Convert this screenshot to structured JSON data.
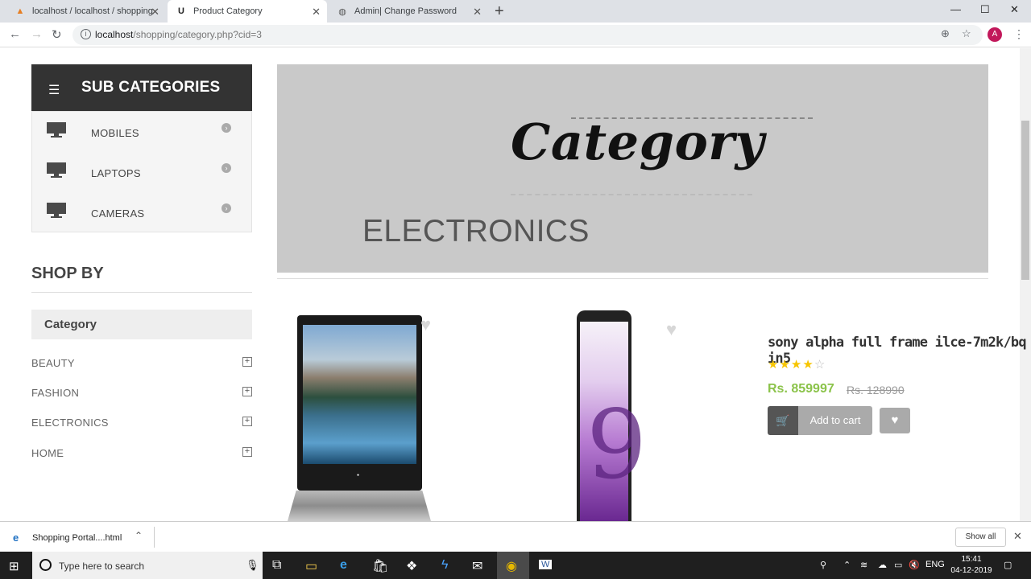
{
  "browser": {
    "tabs": [
      {
        "title": "localhost / localhost / shopping",
        "icon": "phpmyadmin-icon"
      },
      {
        "title": "Product Category",
        "icon": "page-u-icon"
      },
      {
        "title": "Admin| Change Password",
        "icon": "globe-icon"
      }
    ],
    "url_host": "localhost",
    "url_path": "/shopping/category.php?cid=3",
    "profile_initial": "A"
  },
  "sidebar": {
    "subcategories_title": "SUB CATEGORIES",
    "subcategories": [
      {
        "label": "MOBILES"
      },
      {
        "label": "LAPTOPS"
      },
      {
        "label": "CAMERAS"
      }
    ],
    "shop_by_title": "SHOP BY",
    "category_title": "Category",
    "categories": [
      {
        "label": "BEAUTY"
      },
      {
        "label": "FASHION"
      },
      {
        "label": "ELECTRONICS"
      },
      {
        "label": "HOME"
      }
    ]
  },
  "banner": {
    "script_text": "Category",
    "category_name": "ELECTRONICS"
  },
  "product": {
    "title": "sony alpha full frame ilce-7m2k/bq in5",
    "rating": 4,
    "rating_max": 5,
    "price": "Rs. 859997",
    "old_price": "Rs. 128990",
    "add_to_cart_label": "Add to cart",
    "accent_color": "#8bc34a"
  },
  "downloads_bar": {
    "file_name": "Shopping Portal....html",
    "show_all_label": "Show all"
  },
  "taskbar": {
    "search_placeholder": "Type here to search",
    "language": "ENG",
    "time": "15:41",
    "date": "04-12-2019"
  }
}
